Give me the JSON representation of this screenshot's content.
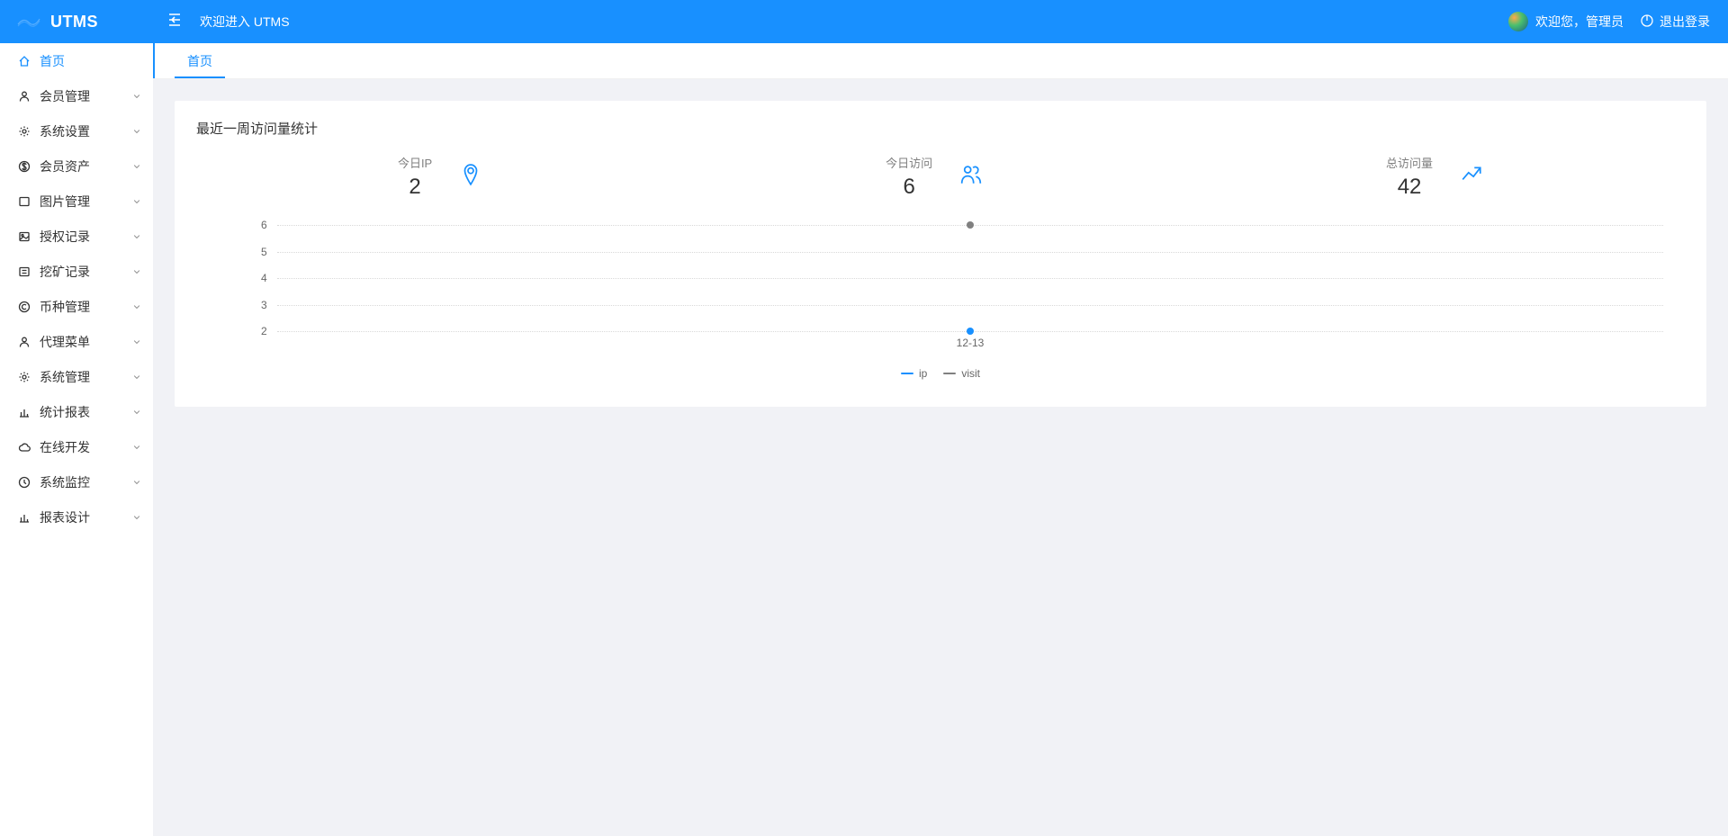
{
  "header": {
    "appName": "UTMS",
    "title": "欢迎进入 UTMS",
    "welcome": "欢迎您，管理员",
    "logout": "退出登录"
  },
  "sidebar": {
    "items": [
      {
        "label": "首页",
        "icon": "home",
        "expandable": false,
        "active": true
      },
      {
        "label": "会员管理",
        "icon": "user",
        "expandable": true
      },
      {
        "label": "系统设置",
        "icon": "gear",
        "expandable": true
      },
      {
        "label": "会员资产",
        "icon": "dollar",
        "expandable": true
      },
      {
        "label": "图片管理",
        "icon": "image-box",
        "expandable": true
      },
      {
        "label": "授权记录",
        "icon": "image-doc",
        "expandable": true
      },
      {
        "label": "挖矿记录",
        "icon": "list-box",
        "expandable": true
      },
      {
        "label": "币种管理",
        "icon": "copyright",
        "expandable": true
      },
      {
        "label": "代理菜单",
        "icon": "user",
        "expandable": true
      },
      {
        "label": "系统管理",
        "icon": "gear",
        "expandable": true
      },
      {
        "label": "统计报表",
        "icon": "bar-chart",
        "expandable": true
      },
      {
        "label": "在线开发",
        "icon": "cloud",
        "expandable": true
      },
      {
        "label": "系统监控",
        "icon": "clock",
        "expandable": true
      },
      {
        "label": "报表设计",
        "icon": "bar-chart",
        "expandable": true
      }
    ]
  },
  "tabs": [
    {
      "label": "首页",
      "active": true
    }
  ],
  "card": {
    "title": "最近一周访问量统计",
    "stats": [
      {
        "label": "今日IP",
        "value": "2",
        "icon": "pin"
      },
      {
        "label": "今日访问",
        "value": "6",
        "icon": "team"
      },
      {
        "label": "总访问量",
        "value": "42",
        "icon": "trend"
      }
    ]
  },
  "chart_data": {
    "type": "line",
    "x": [
      "12-13"
    ],
    "series": [
      {
        "name": "ip",
        "values": [
          2
        ]
      },
      {
        "name": "visit",
        "values": [
          6
        ]
      }
    ],
    "ylim": [
      2,
      6
    ],
    "yticks": [
      2,
      3,
      4,
      5,
      6
    ],
    "xlabel": "",
    "ylabel": "",
    "title": ""
  },
  "legend": {
    "ip": "ip",
    "visit": "visit"
  },
  "icons": {
    "names": {
      "home": "home-icon",
      "user": "user-icon",
      "gear": "gear-icon",
      "dollar": "dollar-icon",
      "image-box": "image-box-icon",
      "image-doc": "image-doc-icon",
      "list-box": "list-box-icon",
      "copyright": "copyright-icon",
      "bar-chart": "bar-chart-icon",
      "cloud": "cloud-icon",
      "clock": "clock-icon",
      "pin": "pin-icon",
      "team": "team-icon",
      "trend": "trend-icon"
    }
  }
}
